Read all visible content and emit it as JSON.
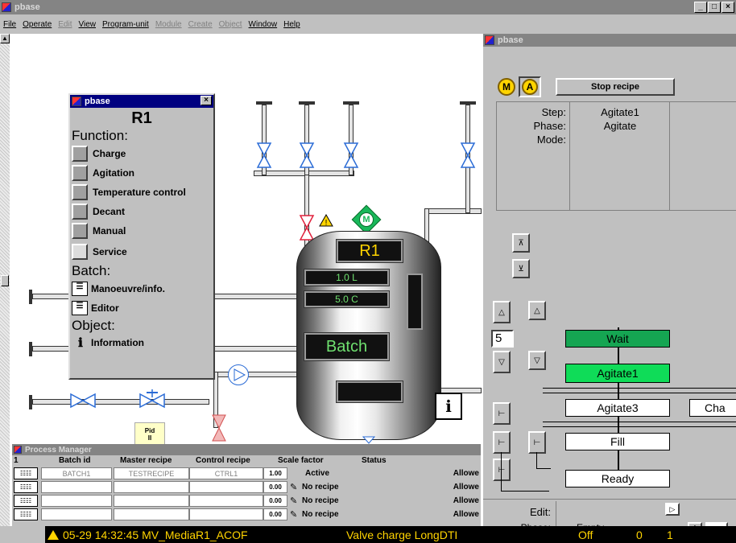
{
  "app": {
    "title": "pbase",
    "controls": [
      "_",
      "□",
      "×"
    ]
  },
  "menu": [
    "File",
    "Operate",
    "Edit",
    "View",
    "Program-unit",
    "Module",
    "Create",
    "Object",
    "Window",
    "Help"
  ],
  "menu_disabled": [
    false,
    false,
    true,
    false,
    false,
    true,
    true,
    true,
    false,
    false
  ],
  "func_win": {
    "title": "pbase",
    "unit": "R1",
    "function_heading": "Function:",
    "functions": [
      "Charge",
      "Agitation",
      "Temperature control",
      "Decant",
      "Manual",
      "Service"
    ],
    "batch_heading": "Batch:",
    "batch_items": [
      "Manoeuvre/info.",
      "Editor"
    ],
    "object_heading": "Object:",
    "object_items": [
      "Information"
    ]
  },
  "process": {
    "tank_label": "R1",
    "volume": "1.0 L",
    "temperature": "5.0 C",
    "mode": "Batch",
    "pid_label": "Pid",
    "pid_value": "II",
    "motor_letter": "M",
    "warning": "!"
  },
  "recipe_win": {
    "title": "pbase",
    "mode_buttons": [
      "M",
      "A"
    ],
    "stop_button": "Stop recipe",
    "step_label": "Step:",
    "step_value": "Agitate1",
    "phase_label": "Phase:",
    "phase_value": "Agitate",
    "mode_label": "Mode:",
    "mode_value": "",
    "counter_value": "5",
    "steps": [
      "Wait",
      "Agitate1",
      "Agitate3",
      "Fill",
      "Ready"
    ],
    "side_step": "Cha",
    "edit_label": "Edit:",
    "phase_partial": "Phase:",
    "empty_partial": "Empty"
  },
  "pm": {
    "title": "Process Manager",
    "index": "1",
    "columns": [
      "Batch id",
      "Master recipe",
      "Control recipe",
      "Scale factor",
      "Status"
    ],
    "rows": [
      {
        "batch": "BATCH1",
        "master": "TESTRECIPE",
        "control": "CTRL1",
        "scale": "1.00",
        "status": "Active",
        "allow": "Allowe"
      },
      {
        "batch": "",
        "master": "",
        "control": "",
        "scale": "0.00",
        "status": "No recipe",
        "allow": "Allowe"
      },
      {
        "batch": "",
        "master": "",
        "control": "",
        "scale": "0.00",
        "status": "No recipe",
        "allow": "Allowe"
      },
      {
        "batch": "",
        "master": "",
        "control": "",
        "scale": "0.00",
        "status": "No recipe",
        "allow": "Allowe"
      }
    ]
  },
  "alarm": {
    "text": "05-29 14:32:45 MV_MediaR1_ACOF",
    "desc": "Valve charge LongDTI",
    "state": "Off",
    "val": "0",
    "val2": "1"
  },
  "colors": {
    "titlebar": "#848484",
    "active_step": "#0fdc58",
    "wait_step": "#15a552",
    "lcd_text": "#6fe06f",
    "alarm_bar": "#000000",
    "alarm_text": "#ffd400"
  }
}
